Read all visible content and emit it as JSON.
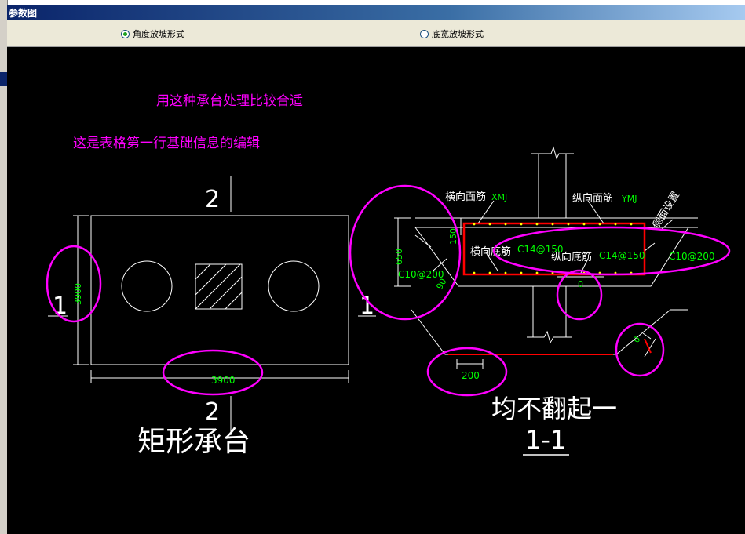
{
  "window": {
    "title": "参数图"
  },
  "options": [
    {
      "label": "角度放坡形式",
      "selected": true
    },
    {
      "label": "底宽放坡形式",
      "selected": false
    }
  ],
  "notes": {
    "line1": "用这种承台处理比较合适",
    "line2": "这是表格第一行基础信息的编辑"
  },
  "plan": {
    "section_mark_top": "2",
    "section_mark_bottom": "2",
    "section_mark_left": "1",
    "section_mark_right": "1",
    "dim_height": "3900",
    "dim_width": "3900",
    "caption": "矩形承台"
  },
  "section": {
    "top_bar_label": "横向面筋",
    "top_bar_code": "XMJ",
    "top_long_label": "纵向面筋",
    "top_long_code": "YMJ",
    "bottom_bar_label": "横向底筋",
    "bottom_bar_spec": "C14@150",
    "bottom_long_label": "纵向底筋",
    "bottom_long_spec": "C14@150",
    "side_bar_spec_left": "C10@200",
    "side_bar_spec_right": "C10@200",
    "side_note": "侧面设置",
    "dim_650": "650",
    "dim_150": "150",
    "dim_90": "90",
    "dim_0_a": "0",
    "dim_0_b": "0",
    "dim_200": "200",
    "caption": "均不翻起一",
    "section_label": "1-1"
  },
  "colors": {
    "annotation": "#ff00ff",
    "dim": "#00ff00",
    "rebar": "#ff0000",
    "outline": "#ffffff"
  }
}
